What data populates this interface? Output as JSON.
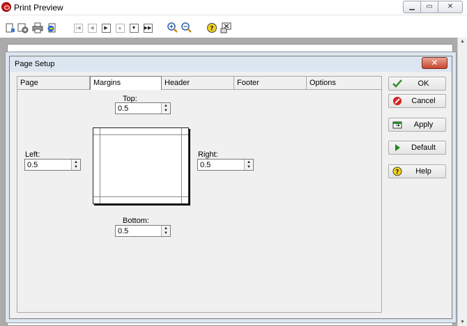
{
  "window": {
    "title": "Print Preview"
  },
  "toolbar": {
    "icons": [
      "new-page-icon",
      "page-setup-icon",
      "print-icon",
      "export-icon",
      "first-page-icon",
      "previous-page-icon",
      "next-page-icon",
      "page-up-icon",
      "page-down-icon",
      "last-page-icon",
      "zoom-in-icon",
      "zoom-out-icon",
      "help-icon",
      "close-preview-icon"
    ]
  },
  "dialog": {
    "title": "Page Setup",
    "close_glyph": "✕",
    "tabs": [
      "Page",
      "Margins",
      "Header",
      "Footer",
      "Options"
    ],
    "active_tab": "Margins",
    "margins": {
      "top": {
        "label": "Top:",
        "value": "0.5"
      },
      "left": {
        "label": "Left:",
        "value": "0.5"
      },
      "right": {
        "label": "Right:",
        "value": "0.5"
      },
      "bottom": {
        "label": "Bottom:",
        "value": "0.5"
      }
    },
    "buttons": {
      "ok": "OK",
      "cancel": "Cancel",
      "apply": "Apply",
      "default": "Default",
      "help": "Help"
    }
  },
  "colors": {
    "ok_check": "#2a8a2a",
    "cancel_red": "#d42020",
    "help_yellow": "#f2d21b",
    "default_green": "#1f8a1f"
  }
}
